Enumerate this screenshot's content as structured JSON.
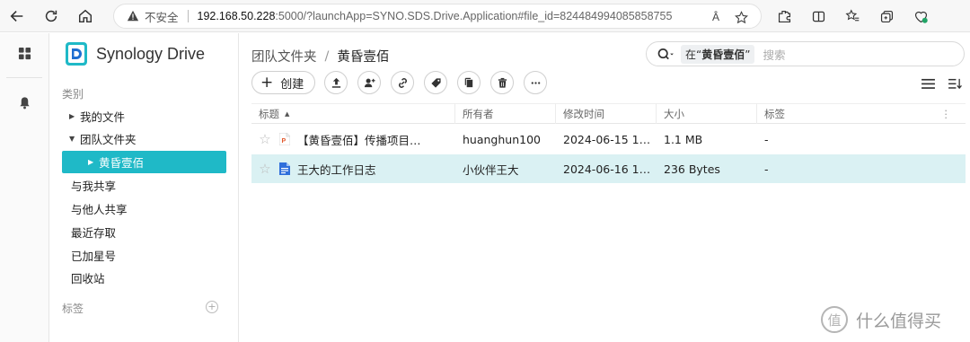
{
  "browser": {
    "insecure_label": "不安全",
    "url_host": "192.168.50.228",
    "url_rest": ":5000/?launchApp=SYNO.SDS.Drive.Application#file_id=824484994085858755",
    "read_aloud_glyph": "Â"
  },
  "app": {
    "brand_name": "Synology Drive",
    "brand_color": "#1fb9c7"
  },
  "sidebar": {
    "category_label": "类别",
    "items": [
      {
        "label": "我的文件",
        "expand": "right"
      },
      {
        "label": "团队文件夹",
        "expand": "down"
      },
      {
        "label": "黄昏壹佰",
        "expand": "right",
        "active": true
      },
      {
        "label": "与我共享"
      },
      {
        "label": "与他人共享"
      },
      {
        "label": "最近存取"
      },
      {
        "label": "已加星号"
      },
      {
        "label": "回收站"
      }
    ],
    "tags_label": "标签",
    "add_tag_glyph": "+"
  },
  "main": {
    "breadcrumb": {
      "root": "团队文件夹",
      "separator": "/",
      "current": "黄昏壹佰"
    },
    "search": {
      "scope_prefix": "在“",
      "scope_name": "黄昏壹佰",
      "scope_suffix": "”",
      "placeholder": "搜索"
    },
    "toolbar": {
      "create_label": "创建",
      "create_glyph": "+"
    },
    "table": {
      "columns": [
        "标题",
        "所有者",
        "修改时间",
        "大小",
        "标签"
      ],
      "sort_glyph": "▲",
      "more_glyph": "⋮",
      "rows": [
        {
          "title": "【黄昏壹佰】传播项目…",
          "owner": "huanghun100",
          "modified": "2024-06-15 1…",
          "size": "1.1 MB",
          "tags": "-",
          "star": "☆",
          "icon": "ppt-file-icon"
        },
        {
          "title": "王大的工作日志",
          "owner": "小伙伴王大",
          "modified": "2024-06-16 1…",
          "size": "236 Bytes",
          "tags": "-",
          "star": "☆",
          "icon": "doc-file-icon"
        }
      ]
    }
  },
  "watermark": {
    "text": "什么值得买",
    "glyph": "值"
  }
}
